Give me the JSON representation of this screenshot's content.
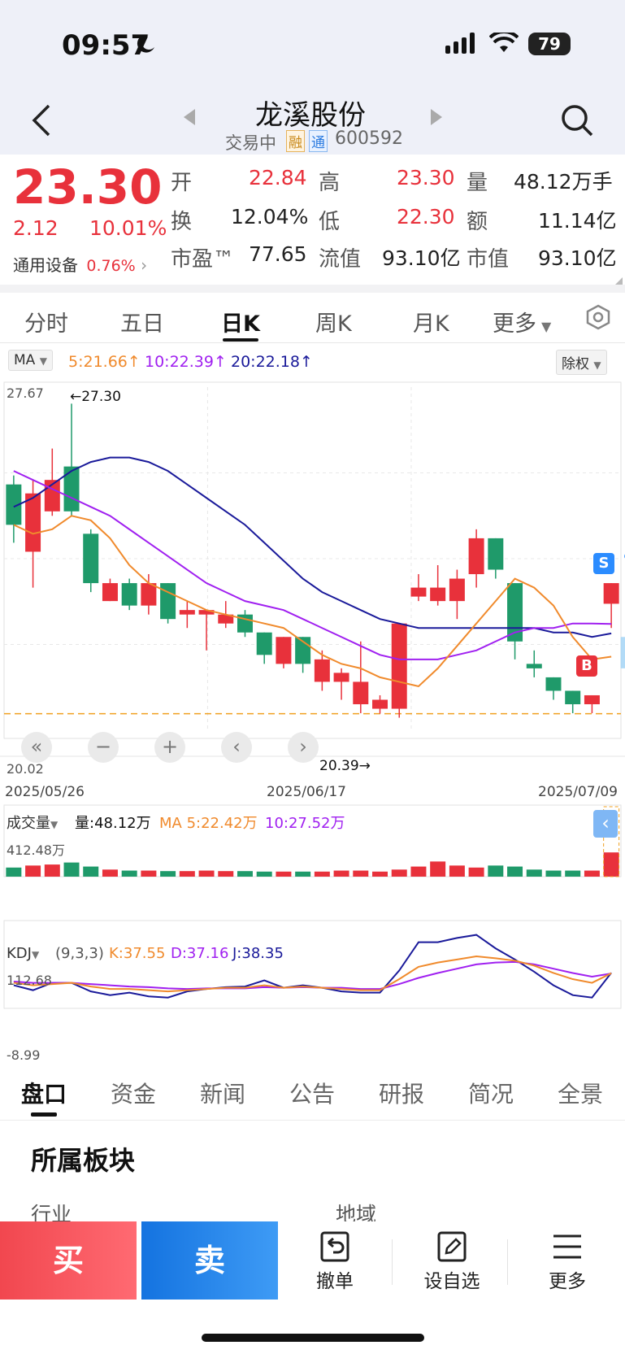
{
  "status": {
    "time": "09:57",
    "battery": "79"
  },
  "header": {
    "title": "龙溪股份",
    "status_text": "交易中",
    "badge_rong": "融",
    "badge_tong": "通",
    "code": "600592"
  },
  "quote": {
    "price": "23.30",
    "change": "2.12",
    "change_pct": "10.01%",
    "sector_name": "通用设备",
    "sector_pct": "0.76%",
    "open_label": "开",
    "open": "22.84",
    "high_label": "高",
    "high": "23.30",
    "vol_label": "量",
    "vol": "48.12万手",
    "turnover_label": "换",
    "turnover": "12.04%",
    "low_label": "低",
    "low": "22.30",
    "amount_label": "额",
    "amount": "11.14亿",
    "pe_label": "市盈™",
    "pe": "77.65",
    "float_cap_label": "流值",
    "float_cap": "93.10亿",
    "mkt_cap_label": "市值",
    "mkt_cap": "93.10亿"
  },
  "tabs": [
    "分时",
    "五日",
    "日K",
    "周K",
    "月K",
    "更多"
  ],
  "ma_bar": {
    "selector": "MA",
    "ma5": "5:21.66",
    "ma10": "10:22.39",
    "ma20": "20:22.18",
    "right": "除权",
    "arrow": "↑"
  },
  "colors": {
    "up": "#e8313b",
    "down": "#1f9a6a",
    "ma5": "#f08a2c",
    "ma10": "#a020f0",
    "ma20": "#1a1a9a",
    "accent": "#1e88e5"
  },
  "chart_data": {
    "type": "candlestick",
    "y_top_label": "27.67",
    "y_bottom_label": "20.02",
    "ylim": [
      20.02,
      27.67
    ],
    "high_marker": "←27.30",
    "low_marker": "20.39→",
    "x_labels": [
      "2025/05/26",
      "2025/06/17",
      "2025/07/09"
    ],
    "candles": [
      {
        "o": 25.5,
        "c": 24.6,
        "h": 25.7,
        "l": 24.2
      },
      {
        "o": 24.0,
        "c": 25.3,
        "h": 25.6,
        "l": 23.2
      },
      {
        "o": 24.9,
        "c": 25.6,
        "h": 26.3,
        "l": 24.8
      },
      {
        "o": 25.9,
        "c": 24.9,
        "h": 27.3,
        "l": 24.8
      },
      {
        "o": 24.4,
        "c": 23.3,
        "h": 24.5,
        "l": 23.1
      },
      {
        "o": 22.9,
        "c": 23.3,
        "h": 23.4,
        "l": 22.9
      },
      {
        "o": 23.3,
        "c": 22.8,
        "h": 23.4,
        "l": 22.7
      },
      {
        "o": 22.8,
        "c": 23.3,
        "h": 23.5,
        "l": 22.6
      },
      {
        "o": 23.3,
        "c": 22.5,
        "h": 23.3,
        "l": 22.4
      },
      {
        "o": 22.6,
        "c": 22.7,
        "h": 22.9,
        "l": 22.3
      },
      {
        "o": 22.6,
        "c": 22.7,
        "h": 22.7,
        "l": 21.8
      },
      {
        "o": 22.4,
        "c": 22.6,
        "h": 22.9,
        "l": 22.3
      },
      {
        "o": 22.6,
        "c": 22.2,
        "h": 22.7,
        "l": 22.1
      },
      {
        "o": 22.2,
        "c": 21.7,
        "h": 22.2,
        "l": 21.5
      },
      {
        "o": 21.5,
        "c": 22.1,
        "h": 22.1,
        "l": 21.4
      },
      {
        "o": 22.1,
        "c": 21.5,
        "h": 22.1,
        "l": 21.3
      },
      {
        "o": 21.1,
        "c": 21.6,
        "h": 21.8,
        "l": 20.9
      },
      {
        "o": 21.1,
        "c": 21.3,
        "h": 21.4,
        "l": 20.7
      },
      {
        "o": 20.6,
        "c": 21.1,
        "h": 22.0,
        "l": 20.4
      },
      {
        "o": 20.5,
        "c": 20.7,
        "h": 20.8,
        "l": 20.39
      },
      {
        "o": 20.5,
        "c": 22.4,
        "h": 22.4,
        "l": 20.3
      },
      {
        "o": 23.0,
        "c": 23.2,
        "h": 23.5,
        "l": 22.9
      },
      {
        "o": 22.9,
        "c": 23.2,
        "h": 23.7,
        "l": 22.8
      },
      {
        "o": 22.9,
        "c": 23.4,
        "h": 23.6,
        "l": 22.5
      },
      {
        "o": 23.5,
        "c": 24.3,
        "h": 24.5,
        "l": 23.2
      },
      {
        "o": 24.3,
        "c": 23.6,
        "h": 24.3,
        "l": 23.4
      },
      {
        "o": 23.3,
        "c": 22.0,
        "h": 23.3,
        "l": 21.6
      },
      {
        "o": 21.5,
        "c": 21.4,
        "h": 21.8,
        "l": 21.2
      },
      {
        "o": 21.2,
        "c": 20.9,
        "h": 21.2,
        "l": 20.7
      },
      {
        "o": 20.9,
        "c": 20.6,
        "h": 20.9,
        "l": 20.4
      },
      {
        "o": 20.6,
        "c": 20.8,
        "h": 20.8,
        "l": 20.4
      },
      {
        "o": 22.84,
        "c": 23.3,
        "h": 23.3,
        "l": 22.3
      }
    ],
    "ma5": [
      24.6,
      24.4,
      24.5,
      24.8,
      24.7,
      24.3,
      23.7,
      23.3,
      23.1,
      22.9,
      22.7,
      22.6,
      22.5,
      22.4,
      22.3,
      22.0,
      21.7,
      21.5,
      21.4,
      21.2,
      21.1,
      21.0,
      21.4,
      21.9,
      22.4,
      22.9,
      23.4,
      23.2,
      22.8,
      22.1,
      21.6,
      21.66
    ],
    "ma10": [
      25.8,
      25.6,
      25.4,
      25.2,
      25.0,
      24.8,
      24.5,
      24.2,
      23.9,
      23.6,
      23.3,
      23.1,
      22.9,
      22.8,
      22.7,
      22.5,
      22.3,
      22.1,
      21.9,
      21.7,
      21.6,
      21.6,
      21.6,
      21.7,
      21.8,
      22.0,
      22.2,
      22.3,
      22.3,
      22.4,
      22.4,
      22.39
    ],
    "ma20": [
      25.0,
      25.2,
      25.5,
      25.8,
      26.0,
      26.1,
      26.1,
      26.0,
      25.8,
      25.5,
      25.2,
      24.9,
      24.6,
      24.2,
      23.8,
      23.4,
      23.1,
      22.9,
      22.7,
      22.5,
      22.4,
      22.3,
      22.3,
      22.3,
      22.3,
      22.3,
      22.3,
      22.3,
      22.2,
      22.2,
      22.1,
      22.18
    ],
    "volume": {
      "selector": "成交量",
      "vol_text": "量:48.12万",
      "ma_text": "MA 5:22.42万",
      "ma10_text": "10:27.52万",
      "y_top_label": "412.48万",
      "values": [
        18,
        22,
        24,
        28,
        20,
        14,
        12,
        12,
        11,
        11,
        12,
        11,
        11,
        10,
        10,
        10,
        10,
        12,
        12,
        10,
        14,
        20,
        30,
        22,
        18,
        22,
        20,
        14,
        12,
        12,
        12,
        48
      ]
    },
    "kdj": {
      "selector": "KDJ",
      "params": "(9,3,3)",
      "k_text": "K:37.55",
      "d_text": "D:37.16",
      "j_text": "J:38.35",
      "y_top_label": "112.68",
      "y_bottom_label": "-8.99",
      "k": [
        22,
        18,
        20,
        22,
        16,
        12,
        12,
        10,
        8,
        10,
        12,
        14,
        14,
        18,
        14,
        16,
        14,
        12,
        10,
        10,
        28,
        48,
        55,
        60,
        65,
        62,
        58,
        50,
        38,
        28,
        22,
        37.55
      ],
      "d": [
        24,
        22,
        22,
        22,
        20,
        18,
        16,
        15,
        13,
        12,
        13,
        13,
        13,
        15,
        14,
        15,
        14,
        14,
        12,
        12,
        20,
        30,
        38,
        45,
        52,
        55,
        56,
        52,
        45,
        38,
        32,
        37.16
      ],
      "j": [
        18,
        10,
        22,
        22,
        8,
        2,
        6,
        0,
        -2,
        8,
        12,
        15,
        16,
        26,
        14,
        18,
        14,
        8,
        6,
        6,
        42,
        88,
        88,
        95,
        100,
        78,
        60,
        40,
        18,
        2,
        -2,
        38.35
      ]
    }
  },
  "chart_ui": {
    "sell_marker": "S",
    "buy_marker": "B"
  },
  "bottom_tabs": [
    "盘口",
    "资金",
    "新闻",
    "公告",
    "研报",
    "简况",
    "全景"
  ],
  "section": {
    "title": "所属板块",
    "left_label": "行业",
    "right_label": "地域"
  },
  "trade": {
    "buy": "买",
    "sell": "卖",
    "cancel": "撤单",
    "watch": "设自选",
    "more": "更多"
  }
}
